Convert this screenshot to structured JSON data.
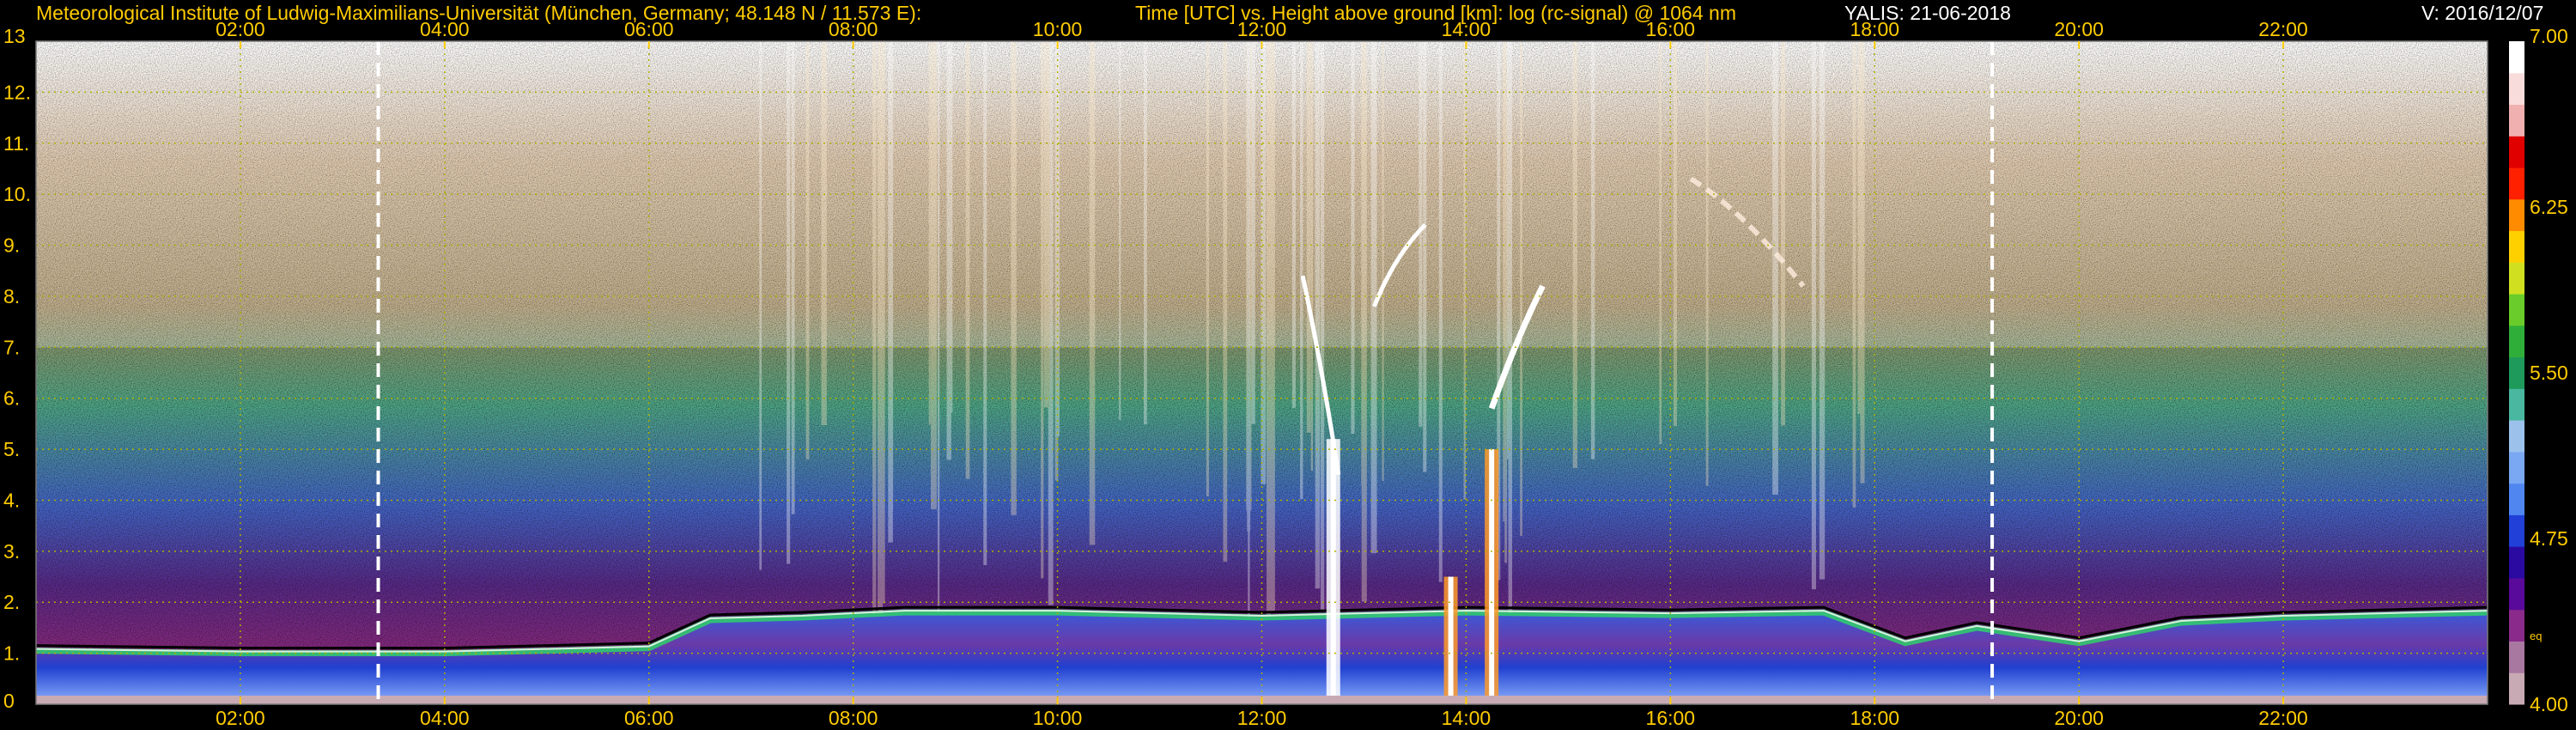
{
  "header": {
    "institute": "Meteorological Institute of Ludwig-Maximilians-Universität (München, Germany; 48.148 N / 11.573 E):",
    "description": "Time [UTC] vs. Height above ground [km]: log (rc-signal) @ 1064 nm",
    "instrument_date": "YALIS: 21-06-2018",
    "version": "V: 2016/12/07"
  },
  "colors": {
    "tick_text": "#ffcc00",
    "grid": "#b0b000",
    "marker": "#ffffff"
  },
  "chart_data": {
    "type": "heatmap",
    "x_tick_labels": [
      "02:00",
      "04:00",
      "06:00",
      "08:00",
      "10:00",
      "12:00",
      "14:00",
      "16:00",
      "18:00",
      "20:00",
      "22:00"
    ],
    "x_tick_hours": [
      2,
      4,
      6,
      8,
      10,
      12,
      14,
      16,
      18,
      20,
      22
    ],
    "xlim_hours": [
      0.0,
      24.0
    ],
    "y_tick_labels": [
      "0",
      "1.",
      "2.",
      "3.",
      "4.",
      "5.",
      "6.",
      "7.",
      "8.",
      "9.",
      "10.",
      "11.",
      "12.",
      "13"
    ],
    "y_tick_values": [
      0,
      1,
      2,
      3,
      4,
      5,
      6,
      7,
      8,
      9,
      10,
      11,
      12,
      13
    ],
    "ylim_km": [
      0,
      13
    ],
    "grid": true,
    "vertical_markers_hours": [
      3.35,
      19.15
    ],
    "colorbar": {
      "range": [
        4.0,
        7.0
      ],
      "tick_labels": [
        "7.00",
        "6.25",
        "5.50",
        "4.75",
        "4.00"
      ],
      "tick_values": [
        7.0,
        6.25,
        5.5,
        4.75,
        4.0
      ],
      "unit_label": "eq",
      "colors": [
        "#c8aab4",
        "#a878a0",
        "#8a2a8a",
        "#5a0a9a",
        "#2a0aa0",
        "#2040d8",
        "#4f86f0",
        "#7aa8f2",
        "#9cc2ec",
        "#4ab8a0",
        "#1e9a5a",
        "#2fae3a",
        "#6acc2a",
        "#d0e020",
        "#ffd000",
        "#ff8c00",
        "#ff2000",
        "#e00000",
        "#f0b0b0",
        "#f8dcdc",
        "#ffffff"
      ]
    },
    "features": {
      "boundary_layer_top_km": [
        [
          0.0,
          1.05
        ],
        [
          2.0,
          1.0
        ],
        [
          4.0,
          1.0
        ],
        [
          6.0,
          1.1
        ],
        [
          6.6,
          1.65
        ],
        [
          7.5,
          1.7
        ],
        [
          8.5,
          1.8
        ],
        [
          10.0,
          1.8
        ],
        [
          12.0,
          1.7
        ],
        [
          14.0,
          1.8
        ],
        [
          16.0,
          1.75
        ],
        [
          17.5,
          1.8
        ],
        [
          18.3,
          1.2
        ],
        [
          19.0,
          1.5
        ],
        [
          20.0,
          1.2
        ],
        [
          21.0,
          1.6
        ],
        [
          22.0,
          1.7
        ],
        [
          24.0,
          1.8
        ]
      ],
      "convective_plumes_hours": [
        12.7,
        13.85,
        14.25
      ],
      "cirrus_hours": [
        [
          12.4,
          13.6
        ],
        [
          14.1,
          15.1
        ],
        [
          16.2,
          17.3
        ]
      ]
    }
  }
}
